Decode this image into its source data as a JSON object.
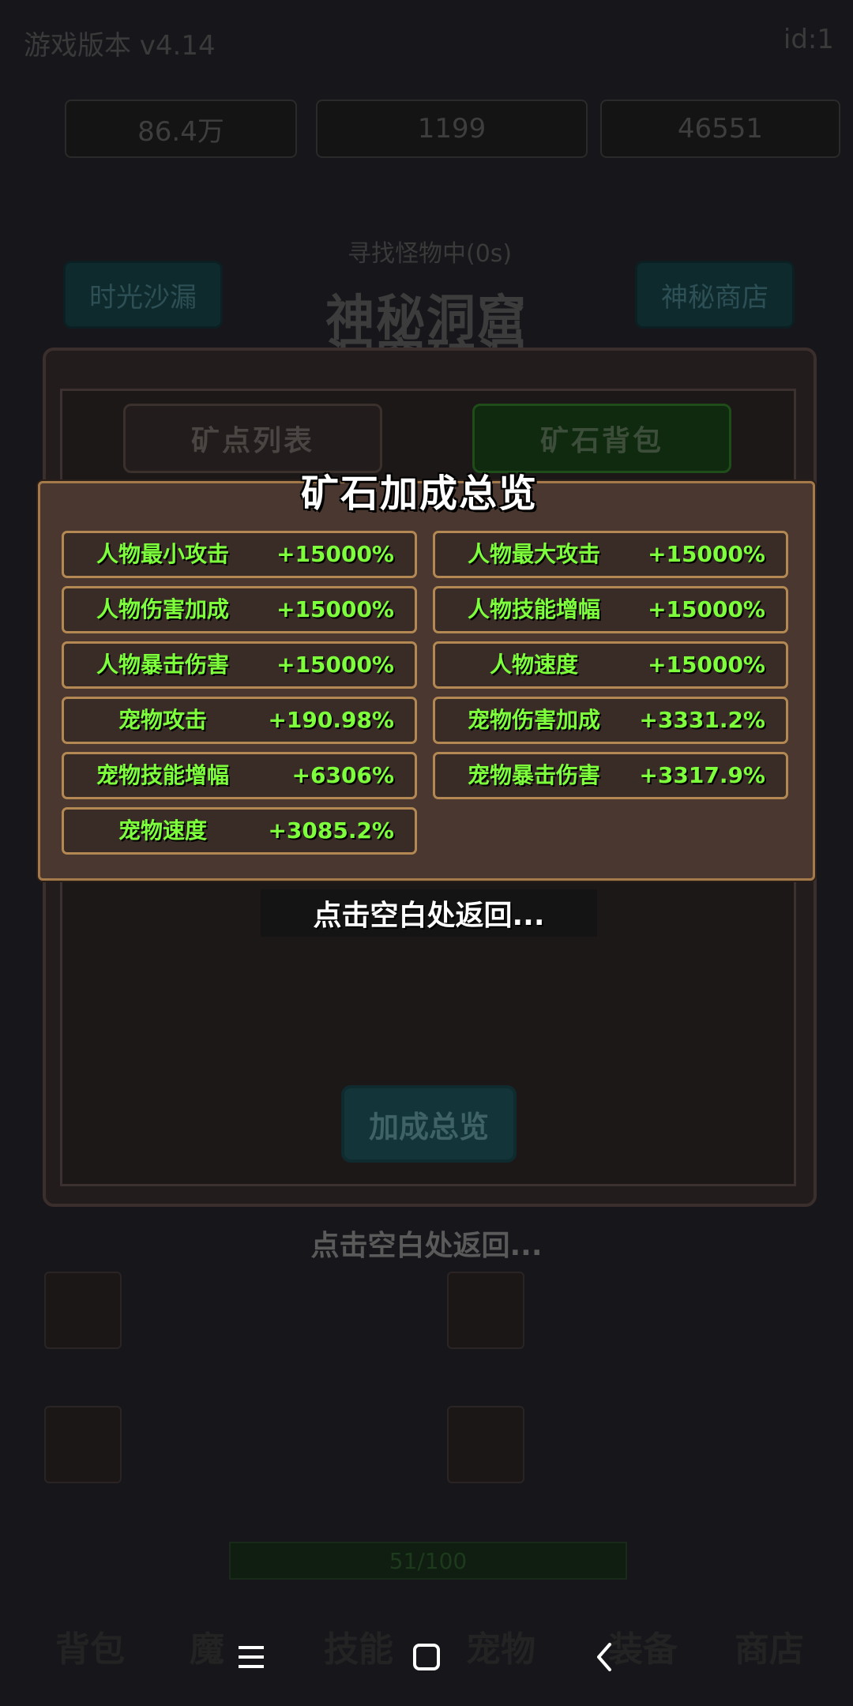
{
  "background": {
    "top_left_text": "游戏版本 v4.14",
    "top_right_text": "id:1",
    "stats": [
      "86.4万",
      "1199",
      "46551"
    ],
    "search_status": "寻找怪物中(0s)",
    "left_button": "时光沙漏",
    "right_button": "神秘商店",
    "title_line1": "神秘洞窟",
    "title_line2": "洞窟矿洞",
    "tabs": [
      "矿点列表",
      "矿石背包"
    ],
    "overview_button": "加成总览",
    "return_hint_bg": "点击空白处返回...",
    "progress": "51/100",
    "bottom_tabs": [
      "背包",
      "魔",
      "技能",
      "宠物",
      "装备",
      "商店"
    ]
  },
  "popup": {
    "title": "矿石加成总览",
    "stats": [
      {
        "name": "人物最小攻击",
        "value": "+15000%"
      },
      {
        "name": "人物最大攻击",
        "value": "+15000%"
      },
      {
        "name": "人物伤害加成",
        "value": "+15000%"
      },
      {
        "name": "人物技能增幅",
        "value": "+15000%"
      },
      {
        "name": "人物暴击伤害",
        "value": "+15000%"
      },
      {
        "name": "人物速度",
        "value": "+15000%"
      },
      {
        "name": "宠物攻击",
        "value": "+190.98%"
      },
      {
        "name": "宠物伤害加成",
        "value": "+3331.2%"
      },
      {
        "name": "宠物技能增幅",
        "value": "+6306%"
      },
      {
        "name": "宠物暴击伤害",
        "value": "+3317.9%"
      },
      {
        "name": "宠物速度",
        "value": "+3085.2%"
      }
    ],
    "return_hint": "点击空白处返回..."
  },
  "colors": {
    "stat_text": "#7dff3c",
    "panel_border": "#b48852",
    "panel_bg": "#4a3830"
  },
  "nav": {
    "icons": [
      "menu-icon",
      "home-square-icon",
      "back-chevron-icon"
    ]
  }
}
